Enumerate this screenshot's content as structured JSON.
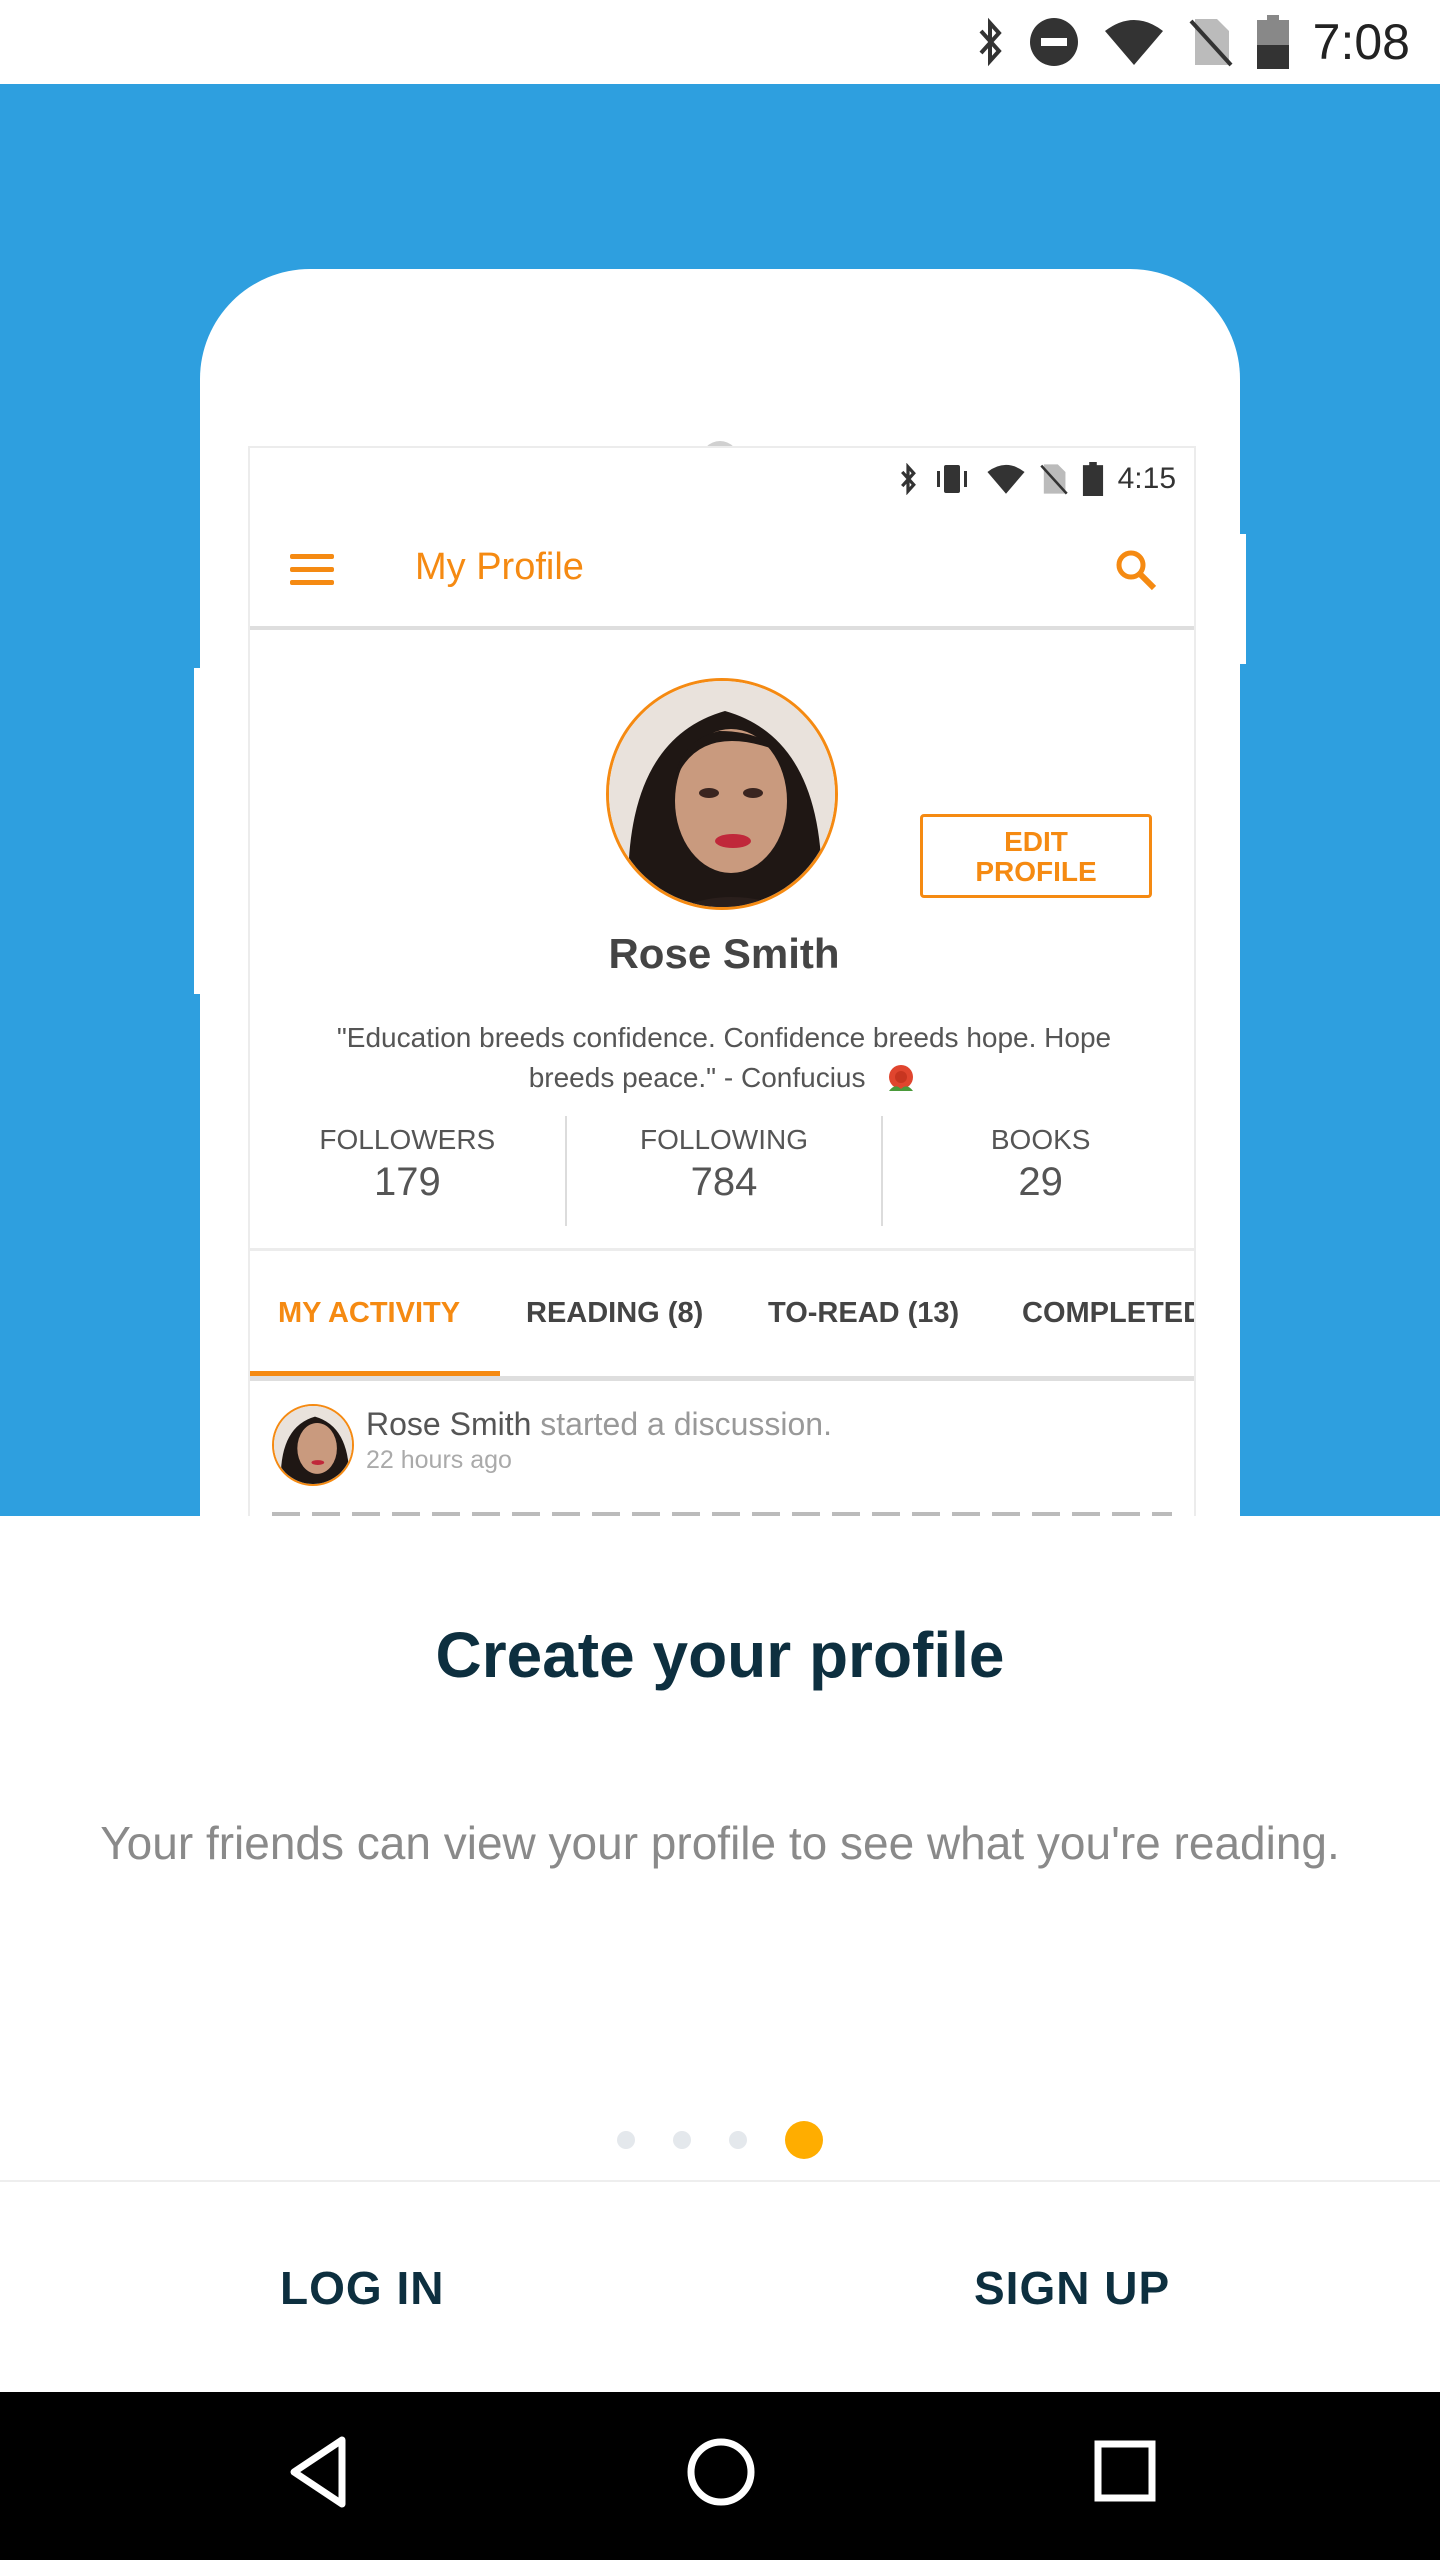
{
  "status_bar": {
    "time": "7:08",
    "icons": [
      "bluetooth-icon",
      "do-not-disturb-icon",
      "wifi-icon",
      "no-sim-icon",
      "battery-icon"
    ]
  },
  "illustration": {
    "status_time": "4:15",
    "toolbar_title": "My Profile",
    "edit_button": "EDIT\nPROFILE",
    "name": "Rose Smith",
    "quote": "\"Education breeds confidence. Confidence breeds hope. Hope breeds peace.\" - Confucius",
    "stats": [
      {
        "label": "FOLLOWERS",
        "value": "179"
      },
      {
        "label": "FOLLOWING",
        "value": "784"
      },
      {
        "label": "BOOKS",
        "value": "29"
      }
    ],
    "tabs": [
      "MY ACTIVITY",
      "READING (8)",
      "TO-READ (13)",
      "COMPLETED"
    ],
    "feed": {
      "user": "Rose Smith",
      "action": "started a discussion.",
      "time": "22 hours ago"
    }
  },
  "onboarding": {
    "title": "Create your profile",
    "description": "Your friends can view your profile to see what you're reading.",
    "page_count": 4,
    "active_page": 4
  },
  "actions": {
    "login": "LOG IN",
    "signup": "SIGN UP"
  },
  "colors": {
    "hero_background": "#2e9fdf",
    "accent_orange": "#f58a12",
    "active_dot": "#ffad00",
    "heading": "#0d2f3f"
  }
}
